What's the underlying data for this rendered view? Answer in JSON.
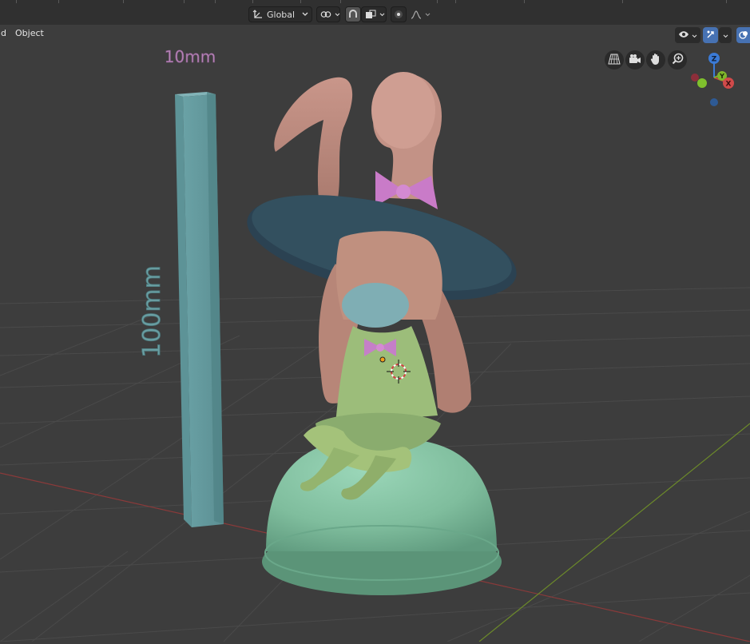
{
  "header": {
    "transform_orientation": "Global"
  },
  "menu": {
    "partial_item": "d",
    "object_label": "Object"
  },
  "scene": {
    "ruler_width_label": "10mm",
    "ruler_height_label": "100mm"
  },
  "gizmo": {
    "z_label": "Z",
    "y_label": "Y",
    "x_label": "X"
  },
  "icons": {
    "orientation": "transform-orientation-icon",
    "pivot": "pivot-point-icon",
    "snap": "snap-icon",
    "proportional": "proportional-editing-icon",
    "visibility": "visibility-icon",
    "gizmo_toggle": "gizmo-toggle-icon",
    "overlay": "overlay-icon",
    "perspective": "grid-perspective-icon",
    "camera": "camera-icon",
    "hand": "hand-pan-icon",
    "zoom": "zoom-icon"
  },
  "colors": {
    "axis_red": "#8a3a3a",
    "axis_green": "#6c8a2a",
    "ruler": "#6a9fa3",
    "hair": "#c08a7c",
    "hat": "#2c4352",
    "dress": "#9fc07c",
    "dome": "#8ccaaa",
    "bow": "#d48ad2",
    "text_purple": "#b685b7"
  }
}
